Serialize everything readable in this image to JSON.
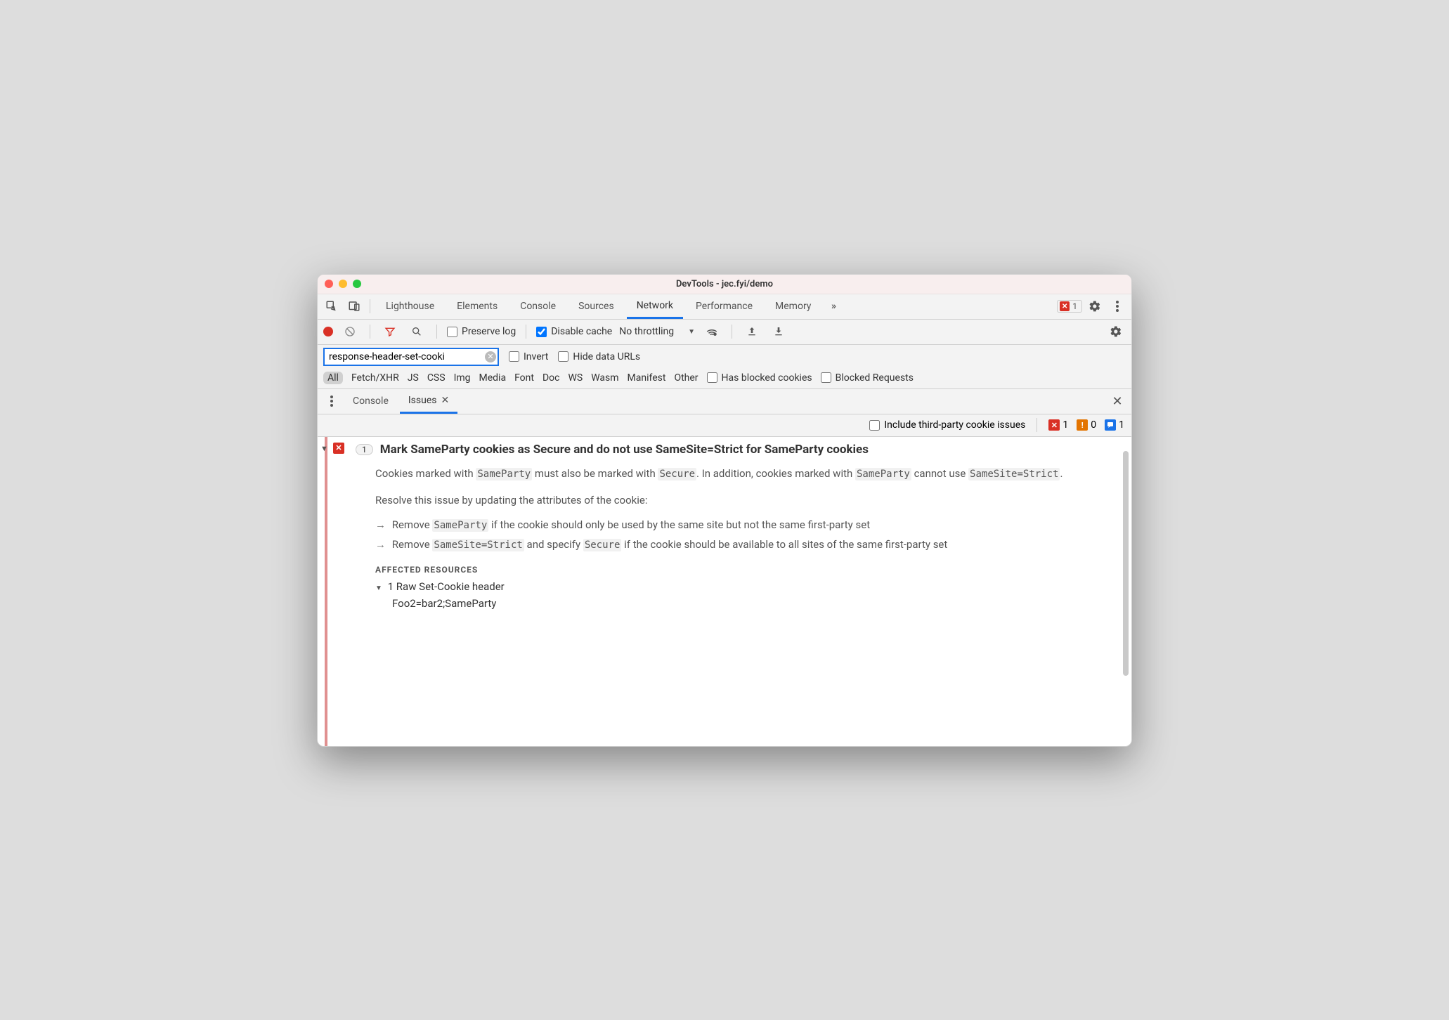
{
  "window": {
    "title": "DevTools - jec.fyi/demo"
  },
  "tabs": {
    "items": [
      "Lighthouse",
      "Elements",
      "Console",
      "Sources",
      "Network",
      "Performance",
      "Memory"
    ],
    "active": "Network",
    "more_icon": "chevrons-right-icon",
    "error_count": "1"
  },
  "toolbar": {
    "preserve_log": "Preserve log",
    "preserve_log_checked": false,
    "disable_cache": "Disable cache",
    "disable_cache_checked": true,
    "throttling": "No throttling"
  },
  "filter": {
    "value": "response-header-set-cooki",
    "invert": "Invert",
    "invert_checked": false,
    "hide_data_urls": "Hide data URLs",
    "hide_data_urls_checked": false
  },
  "types": {
    "items": [
      "All",
      "Fetch/XHR",
      "JS",
      "CSS",
      "Img",
      "Media",
      "Font",
      "Doc",
      "WS",
      "Wasm",
      "Manifest",
      "Other"
    ],
    "selected": "All",
    "has_blocked_cookies": "Has blocked cookies",
    "has_blocked_cookies_checked": false,
    "blocked_requests": "Blocked Requests",
    "blocked_requests_checked": false
  },
  "drawer": {
    "tabs": {
      "console": "Console",
      "issues": "Issues",
      "active": "Issues"
    },
    "include_third_party": "Include third-party cookie issues",
    "include_third_party_checked": false,
    "counts": {
      "error": "1",
      "warning": "0",
      "info": "1"
    }
  },
  "issue": {
    "count": "1",
    "title": "Mark SameParty cookies as Secure and do not use SameSite=Strict for SameParty cookies",
    "para1_pre": "Cookies marked with ",
    "para1_code1": "SameParty",
    "para1_mid1": " must also be marked with ",
    "para1_code2": "Secure",
    "para1_mid2": ". In addition, cookies marked with ",
    "para1_code3": "SameParty",
    "para1_mid3": " cannot use ",
    "para1_code4": "SameSite=Strict",
    "para1_end": ".",
    "para2": "Resolve this issue by updating the attributes of the cookie:",
    "b1_pre": "Remove ",
    "b1_code": "SameParty",
    "b1_post": " if the cookie should only be used by the same site but not the same first-party set",
    "b2_pre": "Remove ",
    "b2_code1": "SameSite=Strict",
    "b2_mid": " and specify ",
    "b2_code2": "Secure",
    "b2_post": " if the cookie should be available to all sites of the same first-party set",
    "affected_label": "AFFECTED RESOURCES",
    "resource_head": "1 Raw Set-Cookie header",
    "resource_value": "Foo2=bar2;SameParty"
  }
}
